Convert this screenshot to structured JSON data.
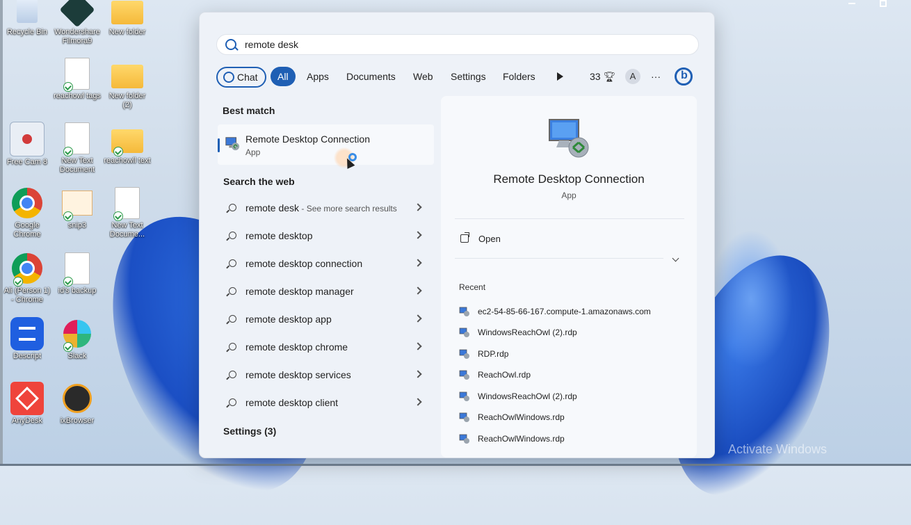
{
  "desktop": {
    "icons": [
      {
        "label": "Recycle Bin"
      },
      {
        "label": "Wondershare Filmora9"
      },
      {
        "label": "New folder"
      },
      {
        "label": "reachowl tags"
      },
      {
        "label": "New folder (2)"
      },
      {
        "label": "Free Cam 8"
      },
      {
        "label": "New Text Document"
      },
      {
        "label": "reachowll text"
      },
      {
        "label": "Google Chrome"
      },
      {
        "label": "snip3"
      },
      {
        "label": "New Text Docume..."
      },
      {
        "label": "Ali (Person 1) - Chrome"
      },
      {
        "label": "id's backup"
      },
      {
        "label": "Descript"
      },
      {
        "label": "Slack"
      },
      {
        "label": "AnyDesk"
      },
      {
        "label": "ixBrowser"
      }
    ],
    "watermark": "Activate Windows"
  },
  "search": {
    "query": "remote desk"
  },
  "tabs": {
    "chat": "Chat",
    "all": "All",
    "apps": "Apps",
    "documents": "Documents",
    "web": "Web",
    "settings": "Settings",
    "folders": "Folders",
    "points": "33",
    "avatar_letter": "A",
    "more": "···"
  },
  "results": {
    "best_match_title": "Best match",
    "best_match": {
      "name": "Remote Desktop Connection",
      "type": "App"
    },
    "web_title": "Search the web",
    "web_items": [
      {
        "text": "remote desk",
        "extra": " - See more search results"
      },
      {
        "text": "remote desktop",
        "extra": ""
      },
      {
        "text": "remote desktop connection",
        "extra": ""
      },
      {
        "text": "remote desktop manager",
        "extra": ""
      },
      {
        "text": "remote desktop app",
        "extra": ""
      },
      {
        "text": "remote desktop chrome",
        "extra": ""
      },
      {
        "text": "remote desktop services",
        "extra": ""
      },
      {
        "text": "remote desktop client",
        "extra": ""
      }
    ],
    "settings_title": "Settings (3)"
  },
  "detail": {
    "title": "Remote Desktop Connection",
    "subtitle": "App",
    "open_label": "Open",
    "recent_title": "Recent",
    "recent": [
      "ec2-54-85-66-167.compute-1.amazonaws.com",
      "WindowsReachOwl (2).rdp",
      "RDP.rdp",
      "ReachOwl.rdp",
      "WindowsReachOwl (2).rdp",
      "ReachOwlWindows.rdp",
      "ReachOwlWindows.rdp"
    ]
  },
  "colors": {
    "accent": "#1f5fb4"
  }
}
